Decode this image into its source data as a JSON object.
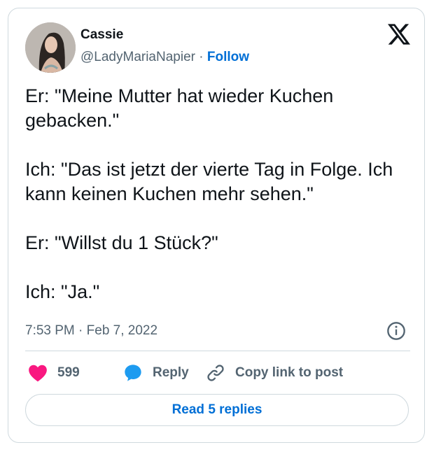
{
  "author": {
    "display_name": "Cassie",
    "handle": "@LadyMariaNapier",
    "separator": " · ",
    "follow_label": "Follow"
  },
  "tweet": {
    "paragraphs": [
      "Er: \"Meine Mutter hat wieder Kuchen gebacken.\"",
      "Ich: \"Das ist jetzt der vierte Tag in Folge. Ich kann keinen Kuchen mehr sehen.\"",
      "Er: \"Willst du 1 Stück?\"",
      "Ich: \"Ja.\""
    ],
    "time": "7:53 PM",
    "date_separator": " · ",
    "date": "Feb 7, 2022"
  },
  "actions": {
    "like_count": "599",
    "reply_label": "Reply",
    "copy_link_label": "Copy link to post"
  },
  "read_replies_label": "Read 5 replies",
  "icons": {
    "brand": "x-logo-icon",
    "info": "info-icon",
    "like": "heart-icon",
    "reply": "speech-bubble-icon",
    "copy": "link-icon"
  },
  "colors": {
    "like": "#f91880",
    "reply_bubble": "#1d9bf0",
    "link_blue": "#006fd6",
    "secondary_text": "#536471",
    "border": "#cfd9de"
  }
}
